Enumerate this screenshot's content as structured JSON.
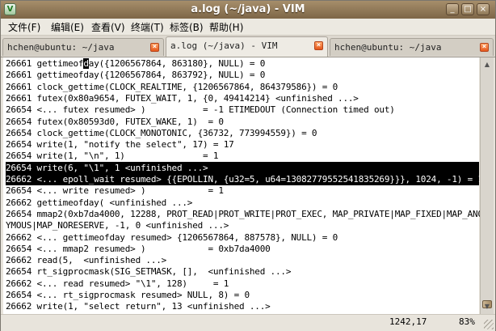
{
  "window": {
    "title": "a.log (~/java) - VIM",
    "icon_label": "V",
    "controls": [
      "minimize-icon",
      "maximize-icon",
      "close-icon"
    ]
  },
  "menu": [
    "文件(F)",
    "编辑(E)",
    "查看(V)",
    "终端(T)",
    "标签(B)",
    "帮助(H)"
  ],
  "tabs": [
    {
      "label": "hchen@ubuntu: ~/java",
      "active": false
    },
    {
      "label": "a.log (~/java) - VIM",
      "active": true
    },
    {
      "label": "hchen@ubuntu: ~/java",
      "active": false
    }
  ],
  "terminal": {
    "lines": [
      "26661 gettimeofday({1206567864, 863180}, NULL) = 0",
      "26661 gettimeofday({1206567864, 863792}, NULL) = 0",
      "26661 clock_gettime(CLOCK_REALTIME, {1206567864, 864379586}) = 0",
      "26661 futex(0x80a9654, FUTEX_WAIT, 1, {0, 49414214} <unfinished ...>",
      "26654 <... futex resumed> )           = -1 ETIMEDOUT (Connection timed out)",
      "26654 futex(0x80593d0, FUTEX_WAKE, 1)  = 0",
      "26654 clock_gettime(CLOCK_MONOTONIC, {36732, 773994559}) = 0",
      "26654 write(1, \"notify the select\", 17) = 17",
      "26654 write(1, \"\\n\", 1)               = 1",
      "26654 write(6, \"\\1\", 1 <unfinished ...>",
      "26662 <... epoll_wait resumed> {{EPOLLIN, {u32=5, u64=13082779552541835269}}}, 1024, -1) = 1",
      "26654 <... write resumed> )            = 1",
      "26662 gettimeofday( <unfinished ...>",
      "26654 mmap2(0xb7da4000, 12288, PROT_READ|PROT_WRITE|PROT_EXEC, MAP_PRIVATE|MAP_FIXED|MAP_ANON",
      "YMOUS|MAP_NORESERVE, -1, 0 <unfinished ...>",
      "26662 <... gettimeofday resumed> {1206567864, 887578}, NULL) = 0",
      "26654 <... mmap2 resumed> )            = 0xb7da4000",
      "26662 read(5,  <unfinished ...>",
      "26654 rt_sigprocmask(SIG_SETMASK, [],  <unfinished ...>",
      "26662 <... read resumed> \"\\1\", 128)     = 1",
      "26654 <... rt_sigprocmask resumed> NULL, 8) = 0",
      "26662 write(1, \"select return\", 13 <unfinished ...>"
    ],
    "highlighted_lines": [
      9,
      10
    ]
  },
  "status": {
    "position": "1242,17",
    "percent": "83%"
  }
}
